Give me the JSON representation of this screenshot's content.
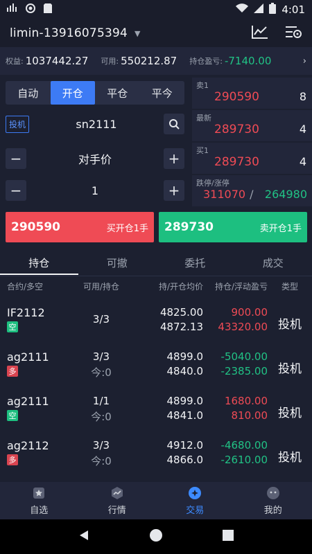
{
  "status_bar": {
    "time": "4:01"
  },
  "header": {
    "account": "limin-13916075394"
  },
  "account_bar": {
    "equity_label": "权益:",
    "equity": "1037442.27",
    "available_label": "可用:",
    "available": "550212.87",
    "pnl_label": "持仓盈亏:",
    "pnl": "-7140.00"
  },
  "order_tabs": [
    "自动",
    "开仓",
    "平仓",
    "平今"
  ],
  "order_form": {
    "hedge_tag": "投机",
    "symbol": "sn2111",
    "price_type": "对手价",
    "quantity": "1",
    "minus": "−",
    "plus": "+"
  },
  "quotes": {
    "ask_label": "卖1",
    "ask_price": "290590",
    "ask_vol": "8",
    "last_label": "最新",
    "last_price": "289730",
    "last_vol": "4",
    "bid_label": "买1",
    "bid_price": "289730",
    "bid_vol": "4",
    "limit_label": "跌停/涨停",
    "limit_up": "311070",
    "limit_sep": "/",
    "limit_down": "264980"
  },
  "trade_buttons": {
    "buy_price": "290590",
    "buy_label": "买开仓1手",
    "sell_price": "289730",
    "sell_label": "卖开仓1手"
  },
  "position_tabs": [
    "持仓",
    "可撤",
    "委托",
    "成交"
  ],
  "table_headers": [
    "合约/多空",
    "可用/持仓",
    "持/开仓均价",
    "持仓/浮动盈亏",
    "类型"
  ],
  "positions": [
    {
      "code": "IF2112",
      "dir": "空",
      "avail": "3/3",
      "today": "",
      "hold_avg": "4825.00",
      "open_avg": "4872.13",
      "hold_pl": "900.00",
      "float_pl": "43320.00",
      "type": "投机"
    },
    {
      "code": "ag2111",
      "dir": "多",
      "avail": "3/3",
      "today": "今:0",
      "hold_avg": "4899.0",
      "open_avg": "4840.0",
      "hold_pl": "-5040.00",
      "float_pl": "-2385.00",
      "type": "投机"
    },
    {
      "code": "ag2111",
      "dir": "空",
      "avail": "1/1",
      "today": "今:0",
      "hold_avg": "4899.0",
      "open_avg": "4841.0",
      "hold_pl": "1680.00",
      "float_pl": "810.00",
      "type": "投机"
    },
    {
      "code": "ag2112",
      "dir": "多",
      "avail": "3/3",
      "today": "今:0",
      "hold_avg": "4912.0",
      "open_avg": "4866.0",
      "hold_pl": "-4680.00",
      "float_pl": "-2610.00",
      "type": "投机"
    }
  ],
  "bottom_nav": [
    "自选",
    "行情",
    "交易",
    "我的"
  ],
  "colors": {
    "accent": "#3d7bf5",
    "up": "#ef4b55",
    "down": "#21c285",
    "bg": "#1c2030"
  }
}
